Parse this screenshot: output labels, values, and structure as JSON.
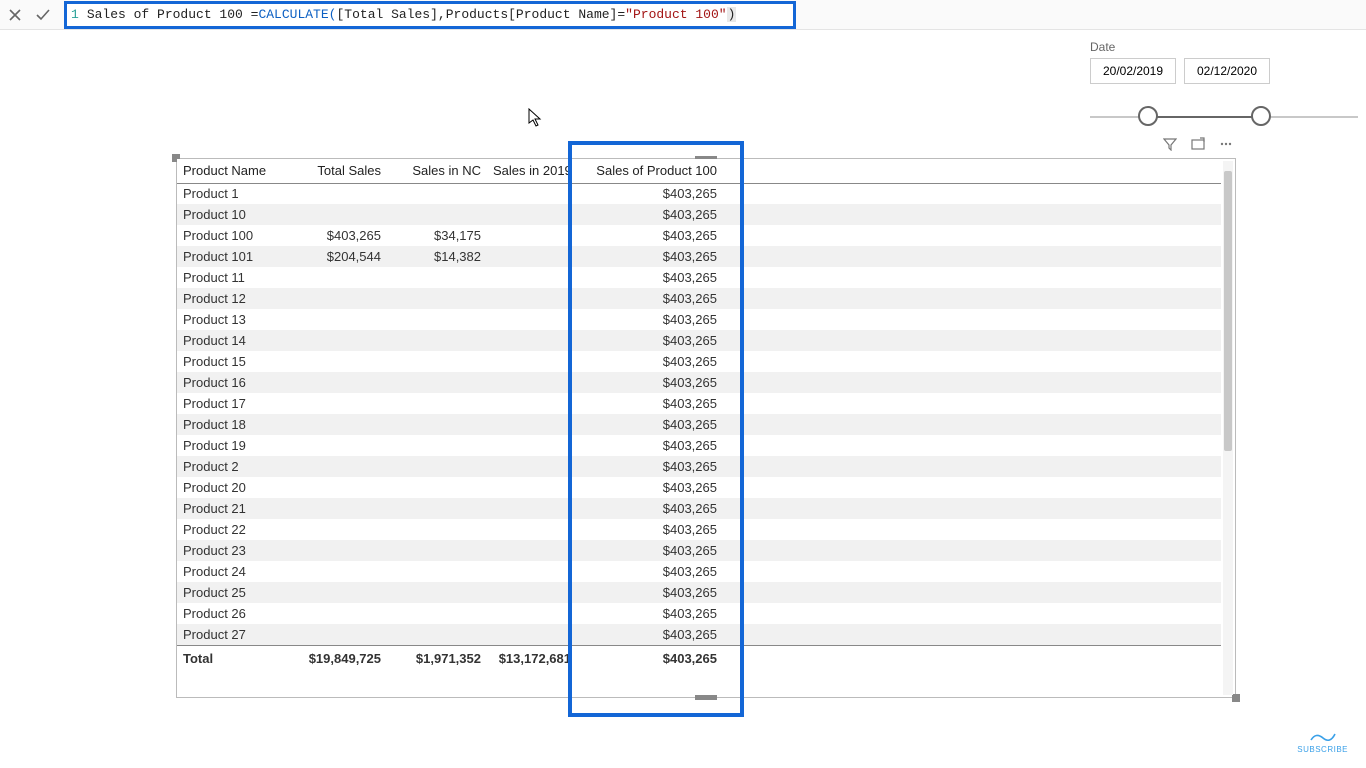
{
  "formula": {
    "line_no": "1",
    "p0": "Sales of Product 100 = ",
    "kw": "CALCULATE",
    "open": "(",
    "arg1": " [Total Sales]",
    "comma": ", ",
    "colref": "Products[Product Name]",
    "eq": " = ",
    "str": "\"Product 100\"",
    "close": " )"
  },
  "date": {
    "label": "Date",
    "start": "20/02/2019",
    "end": "02/12/2020"
  },
  "table": {
    "headers": [
      "Product Name",
      "Total Sales",
      "Sales in NC",
      "Sales in 2019",
      "Sales of Product 100"
    ],
    "rows": [
      {
        "name": "Product 1",
        "total": "",
        "nc": "",
        "y19": "",
        "p100": "$403,265"
      },
      {
        "name": "Product 10",
        "total": "",
        "nc": "",
        "y19": "",
        "p100": "$403,265"
      },
      {
        "name": "Product 100",
        "total": "$403,265",
        "nc": "$34,175",
        "y19": "",
        "p100": "$403,265"
      },
      {
        "name": "Product 101",
        "total": "$204,544",
        "nc": "$14,382",
        "y19": "",
        "p100": "$403,265"
      },
      {
        "name": "Product 11",
        "total": "",
        "nc": "",
        "y19": "",
        "p100": "$403,265"
      },
      {
        "name": "Product 12",
        "total": "",
        "nc": "",
        "y19": "",
        "p100": "$403,265"
      },
      {
        "name": "Product 13",
        "total": "",
        "nc": "",
        "y19": "",
        "p100": "$403,265"
      },
      {
        "name": "Product 14",
        "total": "",
        "nc": "",
        "y19": "",
        "p100": "$403,265"
      },
      {
        "name": "Product 15",
        "total": "",
        "nc": "",
        "y19": "",
        "p100": "$403,265"
      },
      {
        "name": "Product 16",
        "total": "",
        "nc": "",
        "y19": "",
        "p100": "$403,265"
      },
      {
        "name": "Product 17",
        "total": "",
        "nc": "",
        "y19": "",
        "p100": "$403,265"
      },
      {
        "name": "Product 18",
        "total": "",
        "nc": "",
        "y19": "",
        "p100": "$403,265"
      },
      {
        "name": "Product 19",
        "total": "",
        "nc": "",
        "y19": "",
        "p100": "$403,265"
      },
      {
        "name": "Product 2",
        "total": "",
        "nc": "",
        "y19": "",
        "p100": "$403,265"
      },
      {
        "name": "Product 20",
        "total": "",
        "nc": "",
        "y19": "",
        "p100": "$403,265"
      },
      {
        "name": "Product 21",
        "total": "",
        "nc": "",
        "y19": "",
        "p100": "$403,265"
      },
      {
        "name": "Product 22",
        "total": "",
        "nc": "",
        "y19": "",
        "p100": "$403,265"
      },
      {
        "name": "Product 23",
        "total": "",
        "nc": "",
        "y19": "",
        "p100": "$403,265"
      },
      {
        "name": "Product 24",
        "total": "",
        "nc": "",
        "y19": "",
        "p100": "$403,265"
      },
      {
        "name": "Product 25",
        "total": "",
        "nc": "",
        "y19": "",
        "p100": "$403,265"
      },
      {
        "name": "Product 26",
        "total": "",
        "nc": "",
        "y19": "",
        "p100": "$403,265"
      },
      {
        "name": "Product 27",
        "total": "",
        "nc": "",
        "y19": "",
        "p100": "$403,265"
      }
    ],
    "footer": {
      "label": "Total",
      "total": "$19,849,725",
      "nc": "$1,971,352",
      "y19": "$13,172,681",
      "p100": "$403,265"
    }
  },
  "subscribe": "SUBSCRIBE"
}
